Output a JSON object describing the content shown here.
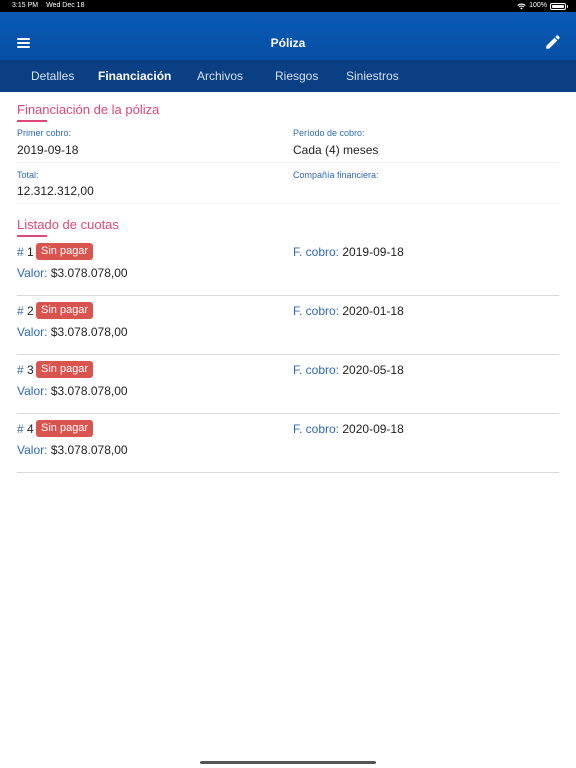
{
  "status_bar": {
    "time": "3:15 PM",
    "date": "Wed Dec 18",
    "battery": "100%",
    "battery_level": 1.0
  },
  "nav": {
    "title": "Póliza",
    "menu_icon": "menu-icon",
    "edit_icon": "pencil-icon"
  },
  "tabs": [
    {
      "label": "Detalles",
      "active": false
    },
    {
      "label": "Financiación",
      "active": true
    },
    {
      "label": "Archivos",
      "active": false
    },
    {
      "label": "Riesgos",
      "active": false
    },
    {
      "label": "Siniestros",
      "active": false
    }
  ],
  "financing": {
    "title": "Financiación de la póliza",
    "first_charge_label": "Primer cobro:",
    "first_charge_value": "2019-09-18",
    "period_label": "Período de cobro:",
    "period_value": "Cada (4) meses",
    "total_label": "Total:",
    "total_value": "12.312.312,00",
    "company_label": "Compañía financiera:",
    "company_value": ""
  },
  "installments": {
    "title": "Listado de cuotas",
    "hash": "#",
    "value_label": "Valor:",
    "date_label": "F. cobro:",
    "items": [
      {
        "number": "1",
        "status": "Sin pagar",
        "value": "$3.078.078,00",
        "date": "2019-09-18"
      },
      {
        "number": "2",
        "status": "Sin pagar",
        "value": "$3.078.078,00",
        "date": "2020-01-18"
      },
      {
        "number": "3",
        "status": "Sin pagar",
        "value": "$3.078.078,00",
        "date": "2020-05-18"
      },
      {
        "number": "4",
        "status": "Sin pagar",
        "value": "$3.078.078,00",
        "date": "2020-09-18"
      }
    ]
  },
  "colors": {
    "nav_blue": "#074fa6",
    "tab_blue": "#0a3f84",
    "accent_pink": "#e0457b",
    "label_blue": "#2d6ab4",
    "badge_red": "#d9534f"
  }
}
